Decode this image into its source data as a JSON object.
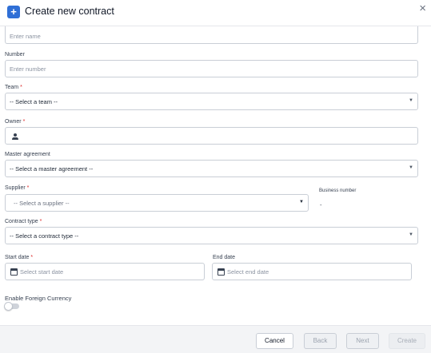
{
  "dialog": {
    "title": "Create new contract",
    "close_glyph": "×",
    "header_icon_glyph": "+"
  },
  "fields": {
    "name": {
      "placeholder": "Enter name"
    },
    "number": {
      "label": "Number",
      "placeholder": "Enter number"
    },
    "team": {
      "label": "Team",
      "required_mark": "*",
      "value": "-- Select a team --"
    },
    "owner": {
      "label": "Owner",
      "required_mark": "*",
      "value": ""
    },
    "master_agreement": {
      "label": "Master agreement",
      "value": "-- Select a master agreement --"
    },
    "supplier": {
      "label": "Supplier",
      "required_mark": "*",
      "value": "-- Select a supplier --"
    },
    "business_number": {
      "label": "Business number",
      "value": "-"
    },
    "contract_type": {
      "label": "Contract type",
      "required_mark": "*",
      "value": "-- Select a contract type --"
    },
    "start_date": {
      "label": "Start date",
      "required_mark": "*",
      "placeholder": "Select start date"
    },
    "end_date": {
      "label": "End date",
      "placeholder": "Select end date"
    },
    "foreign_currency": {
      "label": "Enable Foreign Currency",
      "enabled": false
    }
  },
  "icons": {
    "caret": "▼"
  },
  "footer": {
    "cancel_label": "Cancel",
    "back_label": "Back",
    "next_label": "Next",
    "create_label": "Create"
  },
  "colors": {
    "accent": "#2f6fd6",
    "required": "#dc2626",
    "border": "#c9ced6",
    "footer_bg": "#f3f4f6"
  }
}
